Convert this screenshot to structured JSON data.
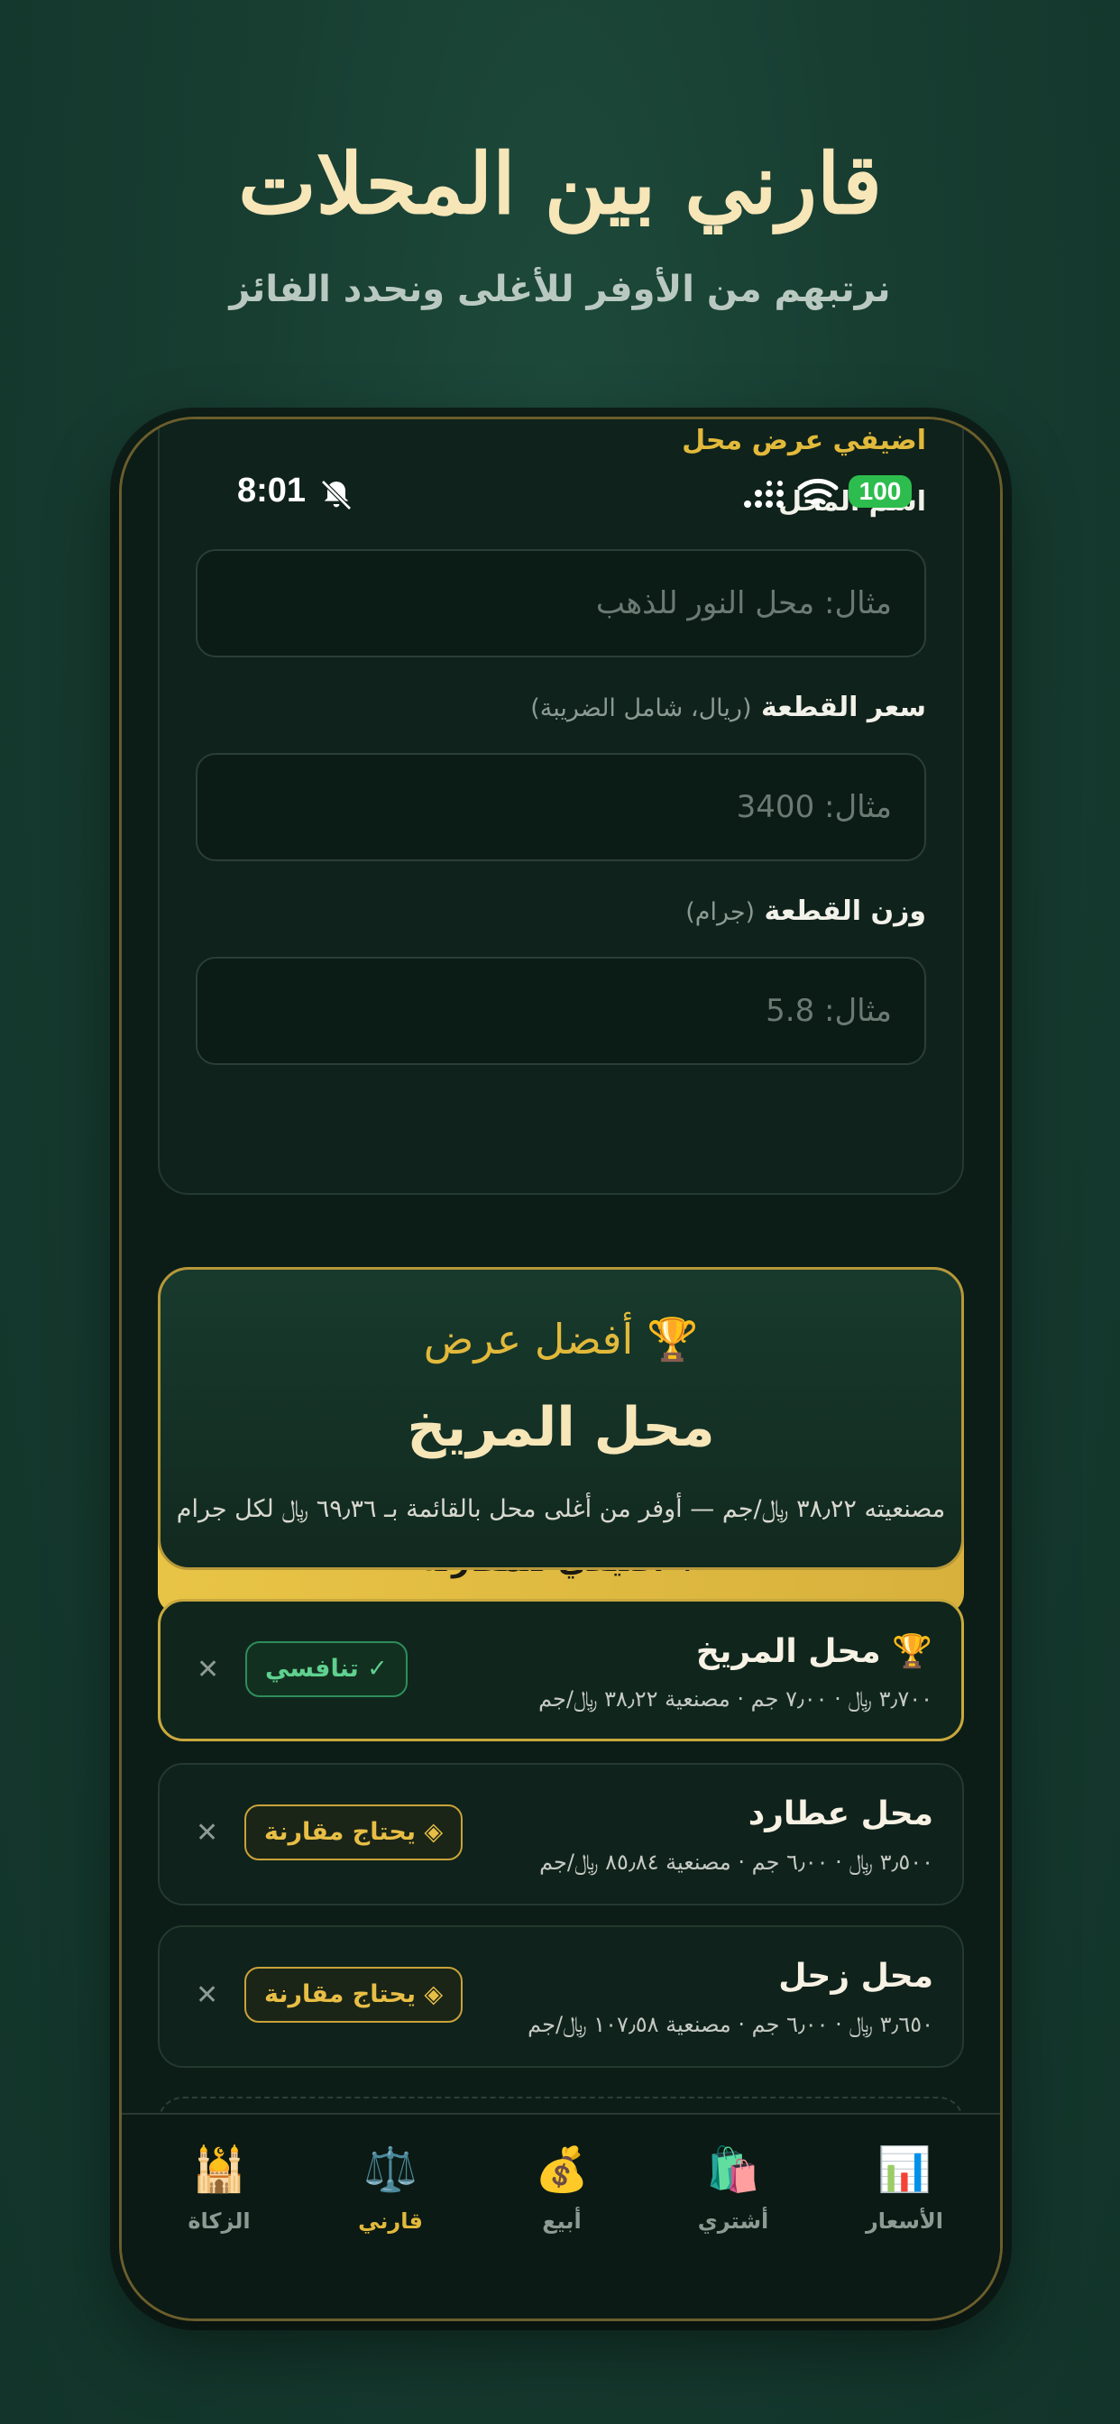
{
  "hero": {
    "title": "قارني بين المحلات",
    "subtitle": "نرتبهم من الأوفر للأغلى ونحدد الفائز"
  },
  "status_bar": {
    "time": "8:01",
    "battery": "100"
  },
  "form": {
    "heading": "اضيفي عرض محل",
    "shop_name_label": "اسم المحل",
    "shop_name_placeholder": "مثال: محل النور للذهب",
    "price_label": "سعر القطعة",
    "price_hint": "(ريال، شامل الضريبة)",
    "price_placeholder": "مثال: 3400",
    "weight_label": "وزن القطعة",
    "weight_hint": "(جرام)",
    "weight_placeholder": "مثال: 5.8",
    "add_button": "+ أضيفي للمقارنة"
  },
  "best_offer": {
    "tag": "🏆 أفضل عرض",
    "name": "محل المريخ",
    "description": "مصنعيته ٣٨٫٢٢ ﷼/جم — أوفر من أغلى محل بالقائمة بـ ٦٩٫٣٦ ﷼ لكل جرام"
  },
  "shops": [
    {
      "name": "🏆 محل المريخ",
      "meta": "٣٫٧٠٠ ﷼ · ٧٫٠٠ جم · مصنعية ٣٨٫٢٢ ﷼/جم",
      "badge": "✓ تنافسي",
      "remove": "✕"
    },
    {
      "name": "محل عطارد",
      "meta": "٣٫٥٠٠ ﷼ · ٦٫٠٠ جم · مصنعية ٨٥٫٨٤ ﷼/جم",
      "badge": "◈ يحتاج مقارنة",
      "remove": "✕"
    },
    {
      "name": "محل زحل",
      "meta": "٣٫٦٥٠ ﷼ · ٦٫٠٠ جم · مصنعية ١٠٧٫٥٨ ﷼/جم",
      "badge": "◈ يحتاج مقارنة",
      "remove": "✕"
    }
  ],
  "tabs": [
    {
      "label": "الأسعار",
      "icon": "📊"
    },
    {
      "label": "أشتري",
      "icon": "🛍️"
    },
    {
      "label": "أبيع",
      "icon": "💰"
    },
    {
      "label": "قارني",
      "icon": "⚖️"
    },
    {
      "label": "الزكاة",
      "icon": "🕌"
    }
  ],
  "colors": {
    "gold": "#e2b93b",
    "background": "#173c30",
    "success": "#5fd08f"
  }
}
